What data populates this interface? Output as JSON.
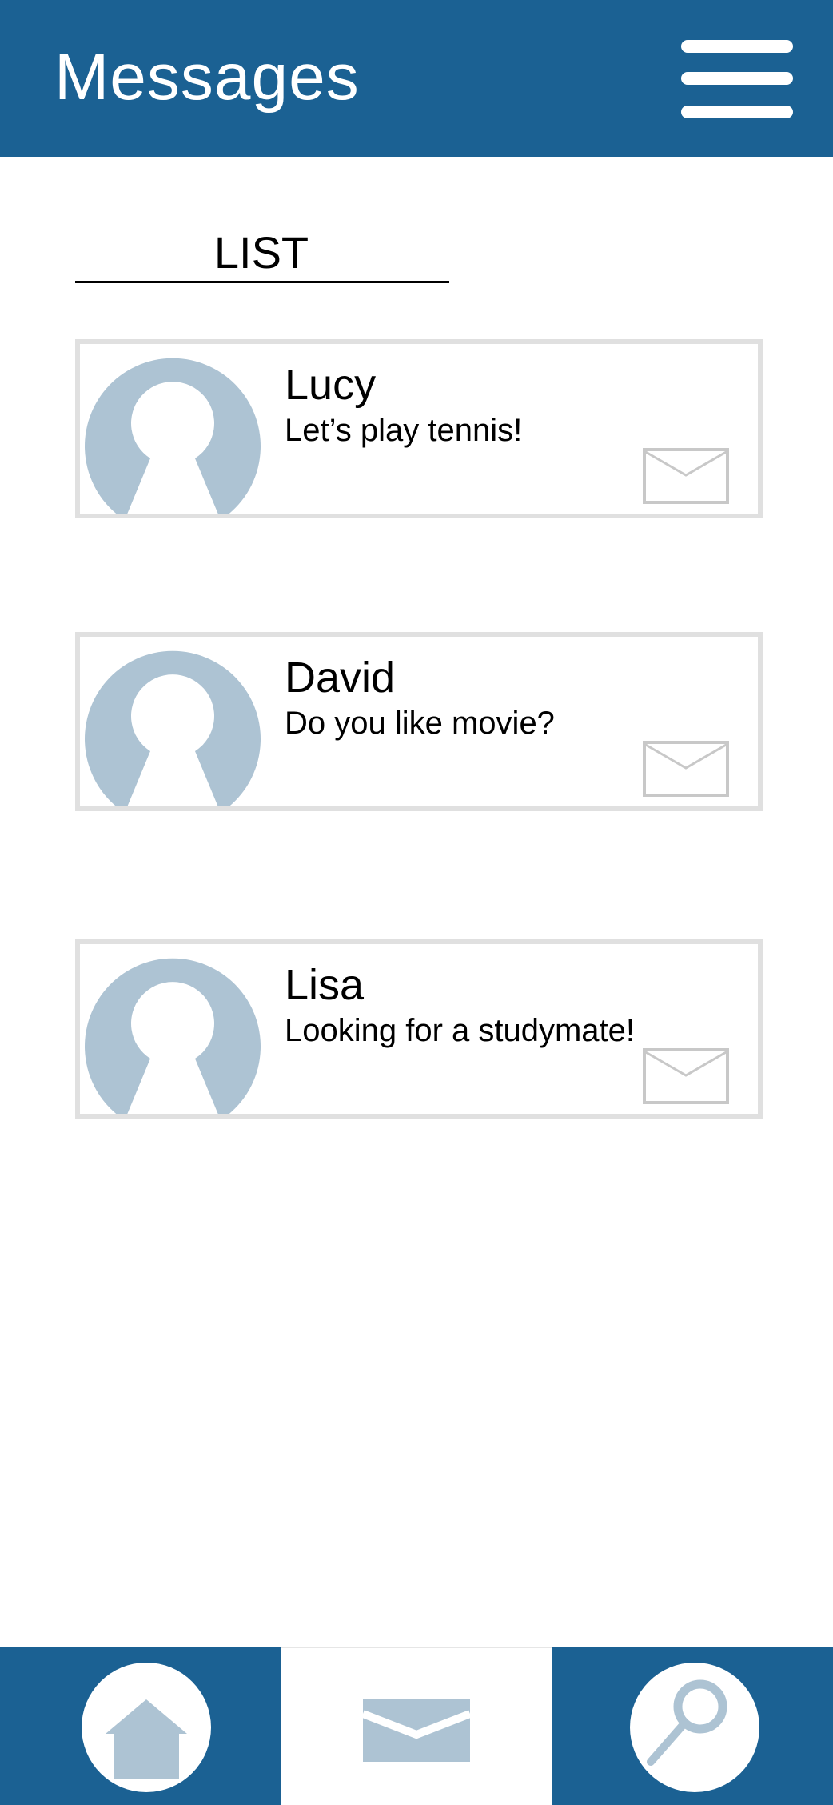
{
  "header": {
    "title": "Messages",
    "menu_icon": "hamburger-menu-icon",
    "background": "#1b6193"
  },
  "list": {
    "title": "LIST"
  },
  "conversations": [
    {
      "name": "Lucy",
      "message": "Let’s play tennis!",
      "avatar_icon": "user-avatar-icon",
      "action_icon": "envelope-icon"
    },
    {
      "name": "David",
      "message": "Do you like movie?",
      "avatar_icon": "user-avatar-icon",
      "action_icon": "envelope-icon"
    },
    {
      "name": "Lisa",
      "message": "Looking for a studymate!",
      "avatar_icon": "user-avatar-icon",
      "action_icon": "envelope-icon"
    }
  ],
  "bottom_nav": {
    "items": [
      {
        "icon": "home-icon",
        "active": false
      },
      {
        "icon": "envelope-icon",
        "active": true
      },
      {
        "icon": "search-icon",
        "active": false
      }
    ]
  },
  "colors": {
    "primary": "#1b6193",
    "icon_fill": "#adc3d3",
    "card_border": "#e0e0e0",
    "envelope_stroke": "#c8c8c8"
  }
}
